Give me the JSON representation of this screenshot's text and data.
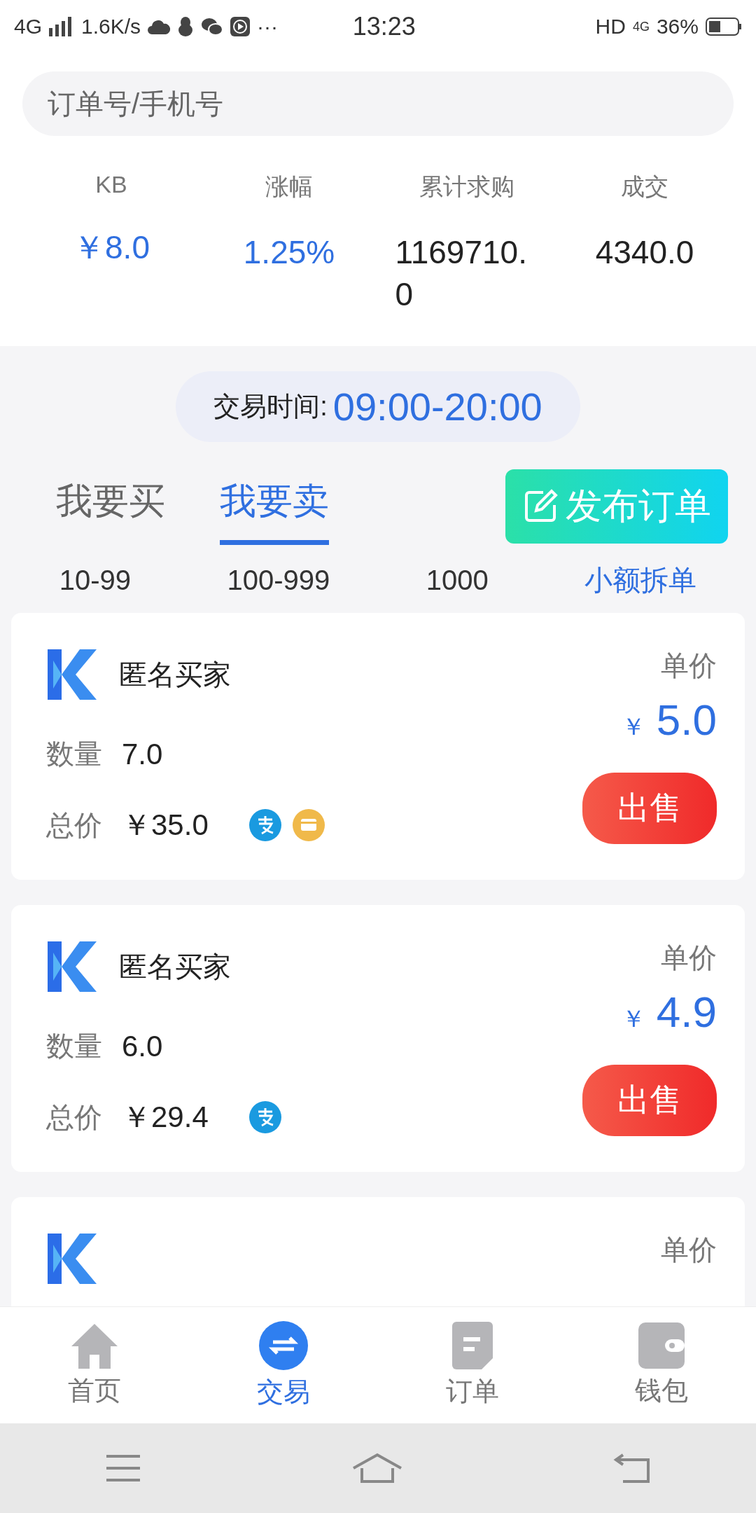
{
  "status_bar": {
    "network": "4G",
    "speed": "1.6K/s",
    "more": "···",
    "time": "13:23",
    "hd": "HD",
    "network_right": "4G",
    "battery": "36%"
  },
  "search": {
    "placeholder": "订单号/手机号"
  },
  "stats": [
    {
      "label": "KB",
      "value": "￥8.0",
      "highlight": true
    },
    {
      "label": "涨幅",
      "value": "1.25%",
      "highlight": true
    },
    {
      "label": "累计求购",
      "value": "1169710.0",
      "highlight": false
    },
    {
      "label": "成交",
      "value": "4340.0",
      "highlight": false
    }
  ],
  "trade_time": {
    "label": "交易时间:",
    "value": "09:00-20:00"
  },
  "tabs": [
    {
      "label": "我要买",
      "selected": false
    },
    {
      "label": "我要卖",
      "selected": true
    }
  ],
  "publish_button": "发布订单",
  "filters": [
    {
      "label": "10-99",
      "selected": false
    },
    {
      "label": "100-999",
      "selected": false
    },
    {
      "label": "1000",
      "selected": false
    },
    {
      "label": "小额拆单",
      "selected": true
    }
  ],
  "orders": [
    {
      "name": "匿名买家",
      "price_label": "单价",
      "currency": "￥",
      "price": "5.0",
      "qty_label": "数量",
      "qty": "7.0",
      "total_label": "总价",
      "total": "￥35.0",
      "payments": [
        {
          "kind": "alipay"
        },
        {
          "kind": "card"
        }
      ],
      "action": "出售"
    },
    {
      "name": "匿名买家",
      "price_label": "单价",
      "currency": "￥",
      "price": "4.9",
      "qty_label": "数量",
      "qty": "6.0",
      "total_label": "总价",
      "total": "￥29.4",
      "payments": [
        {
          "kind": "alipay"
        }
      ],
      "action": "出售"
    },
    {
      "price_label": "单价"
    }
  ],
  "bottom_nav": [
    {
      "label": "首页",
      "kind": "home",
      "selected": false
    },
    {
      "label": "交易",
      "kind": "exchange",
      "selected": true
    },
    {
      "label": "订单",
      "kind": "document",
      "selected": false
    },
    {
      "label": "钱包",
      "kind": "wallet",
      "selected": false
    }
  ]
}
